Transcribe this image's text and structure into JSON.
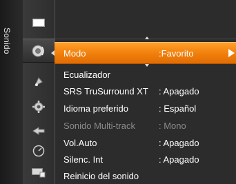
{
  "sidebar": {
    "title": "Sonido"
  },
  "icons": [
    "picture-icon",
    "sound-icon",
    "channel-icon",
    "setup-icon",
    "input-icon",
    "application-icon",
    "support-icon"
  ],
  "menu": {
    "items": [
      {
        "label": "Modo",
        "value": ":Favorito",
        "selected": true
      },
      {
        "label": "Ecualizador",
        "value": ""
      },
      {
        "label": "SRS TruSurround XT",
        "value": ": Apagado"
      },
      {
        "label": "Idioma preferido",
        "value": ": Español"
      },
      {
        "label": "Sonido Multi-track",
        "value": ": Mono",
        "disabled": true
      },
      {
        "label": "Vol.Auto",
        "value": ": Apagado"
      },
      {
        "label": "Silenc. Int",
        "value": ": Apagado"
      },
      {
        "label": "Reinicio del sonido",
        "value": ""
      }
    ]
  },
  "colors": {
    "highlight": "#f7890f",
    "background": "#2c2c2c",
    "disabled_text": "#8a8a8a"
  }
}
